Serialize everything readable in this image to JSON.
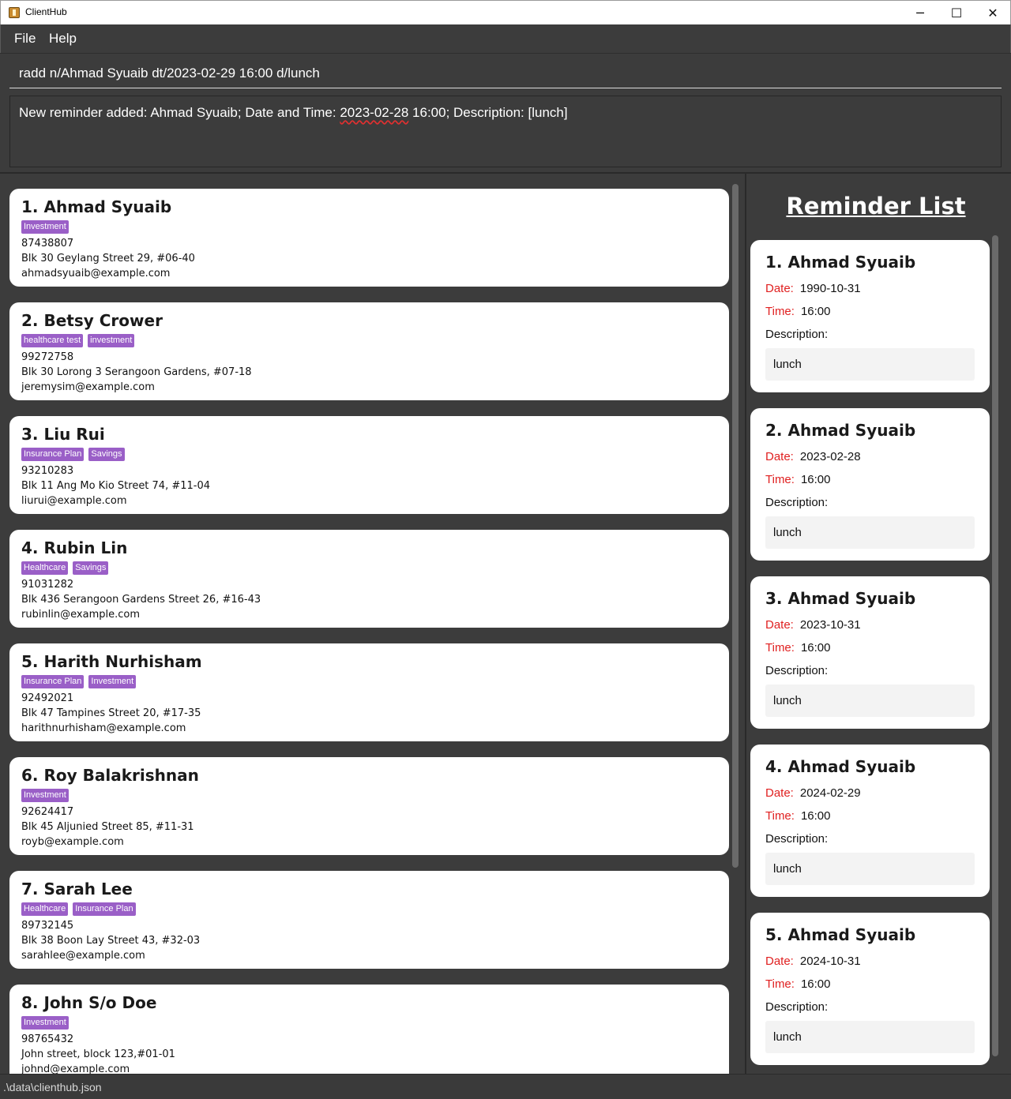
{
  "window": {
    "title": "ClientHub",
    "minimize": "─",
    "maximize": "☐",
    "close": "✕"
  },
  "menu": {
    "file": "File",
    "help": "Help"
  },
  "command": {
    "value": "radd n/Ahmad Syuaib dt/2023-02-29 16:00 d/lunch"
  },
  "result": {
    "prefix": "New reminder added: Ahmad Syuaib; Date and Time: ",
    "date": "2023-02-28",
    "suffix": " 16:00; Description: [lunch]"
  },
  "persons": [
    {
      "name": "1. Ahmad Syuaib",
      "tags": [
        "Investment"
      ],
      "phone": "87438807",
      "address": "Blk 30 Geylang Street 29, #06-40",
      "email": "ahmadsyuaib@example.com"
    },
    {
      "name": "2. Betsy Crower",
      "tags": [
        "healthcare test",
        "investment"
      ],
      "phone": "99272758",
      "address": "Blk 30 Lorong 3 Serangoon Gardens, #07-18",
      "email": "jeremysim@example.com"
    },
    {
      "name": "3. Liu Rui",
      "tags": [
        "Insurance Plan",
        "Savings"
      ],
      "phone": "93210283",
      "address": "Blk 11 Ang Mo Kio Street 74, #11-04",
      "email": "liurui@example.com"
    },
    {
      "name": "4. Rubin Lin",
      "tags": [
        "Healthcare",
        "Savings"
      ],
      "phone": "91031282",
      "address": "Blk 436 Serangoon Gardens Street 26, #16-43",
      "email": "rubinlin@example.com"
    },
    {
      "name": "5. Harith Nurhisham",
      "tags": [
        "Insurance Plan",
        "Investment"
      ],
      "phone": "92492021",
      "address": "Blk 47 Tampines Street 20, #17-35",
      "email": "harithnurhisham@example.com"
    },
    {
      "name": "6. Roy Balakrishnan",
      "tags": [
        "Investment"
      ],
      "phone": "92624417",
      "address": "Blk 45 Aljunied Street 85, #11-31",
      "email": "royb@example.com"
    },
    {
      "name": "7. Sarah Lee",
      "tags": [
        "Healthcare",
        "Insurance Plan"
      ],
      "phone": "89732145",
      "address": "Blk 38 Boon Lay Street 43, #32-03",
      "email": "sarahlee@example.com"
    },
    {
      "name": "8. John S/o Doe",
      "tags": [
        "Investment"
      ],
      "phone": "98765432",
      "address": "John street, block 123,#01-01",
      "email": "johnd@example.com"
    }
  ],
  "reminders": {
    "heading": "Reminder List",
    "date_label": "Date:",
    "time_label": "Time:",
    "description_label": "Description:",
    "items": [
      {
        "name": "1.  Ahmad Syuaib",
        "date": "1990-10-31",
        "time": "16:00",
        "description": "lunch"
      },
      {
        "name": "2.  Ahmad Syuaib",
        "date": "2023-02-28",
        "time": "16:00",
        "description": "lunch"
      },
      {
        "name": "3.  Ahmad Syuaib",
        "date": "2023-10-31",
        "time": "16:00",
        "description": "lunch"
      },
      {
        "name": "4.  Ahmad Syuaib",
        "date": "2024-02-29",
        "time": "16:00",
        "description": "lunch"
      },
      {
        "name": "5.  Ahmad Syuaib",
        "date": "2024-10-31",
        "time": "16:00",
        "description": "lunch"
      }
    ]
  },
  "status": {
    "path": ".\\data\\clienthub.json"
  }
}
